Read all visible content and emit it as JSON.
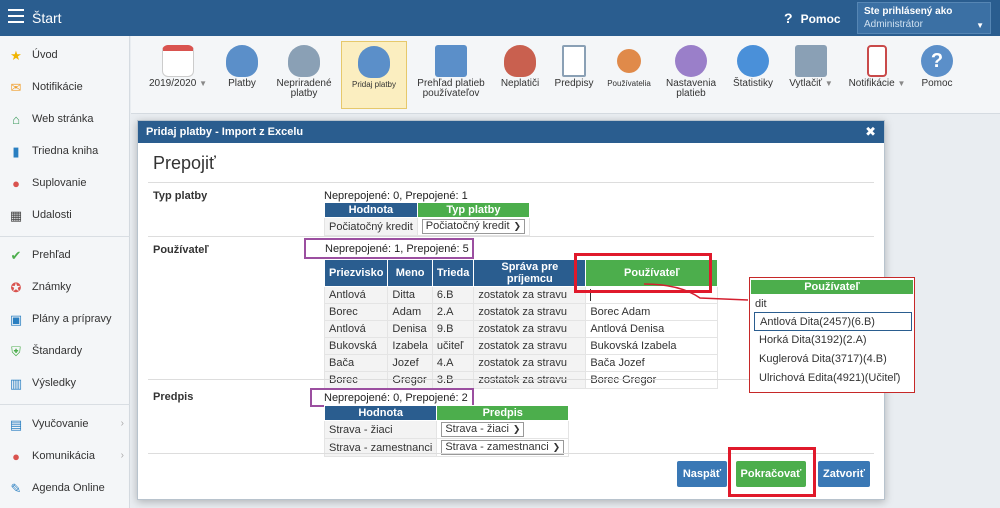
{
  "topbar": {
    "title": "Štart",
    "help": "Pomoc",
    "user_line1": "Ste prihlásený ako",
    "user_line2": "Administrátor"
  },
  "sidebar": [
    {
      "label": "Úvod",
      "icon": "star-icon",
      "color": "#f0b400"
    },
    {
      "label": "Notifikácie",
      "icon": "envelope-icon",
      "color": "#f0a030"
    },
    {
      "label": "Web stránka",
      "icon": "home-icon",
      "color": "#3a9a5b"
    },
    {
      "label": "Triedna kniha",
      "icon": "book-icon",
      "color": "#2a7fc1"
    },
    {
      "label": "Suplovanie",
      "icon": "person-icon",
      "color": "#d9534f"
    },
    {
      "label": "Udalosti",
      "icon": "calendar-icon",
      "color": "#444"
    },
    {
      "label": "Prehľad",
      "icon": "check-circle-icon",
      "color": "#4cae4c"
    },
    {
      "label": "Známky",
      "icon": "grade-icon",
      "color": "#d9534f"
    },
    {
      "label": "Plány a prípravy",
      "icon": "briefcase-icon",
      "color": "#2a7fc1"
    },
    {
      "label": "Štandardy",
      "icon": "shield-icon",
      "color": "#4cae4c"
    },
    {
      "label": "Výsledky",
      "icon": "bar-chart-icon",
      "color": "#2a7fc1"
    },
    {
      "label": "Vyučovanie",
      "icon": "open-book-icon",
      "color": "#2a7fc1"
    },
    {
      "label": "Komunikácia",
      "icon": "chat-icon",
      "color": "#d9534f"
    },
    {
      "label": "Agenda Online",
      "icon": "pen-icon",
      "color": "#2a7fc1"
    }
  ],
  "toolbar": [
    {
      "label": "2019/2020",
      "icon": "calendar-icon",
      "color": "#f2f2f2"
    },
    {
      "label": "Platby",
      "icon": "money-bag-icon",
      "color": "#5b8fc9"
    },
    {
      "label": "Nepriradené platby",
      "icon": "money-bag-question-icon",
      "color": "#8aa0b5"
    },
    {
      "label": "Pridaj platby",
      "icon": "money-bag-add-icon",
      "color": "#5b8fc9"
    },
    {
      "label": "Prehľad platieb používateľov",
      "icon": "ledger-icon",
      "color": "#5b8fc9"
    },
    {
      "label": "Neplatiči",
      "icon": "money-bag-clock-icon",
      "color": "#c9604f"
    },
    {
      "label": "Predpisy",
      "icon": "document-icon",
      "color": "#8aa0b5"
    },
    {
      "label": "Používatelia",
      "icon": "user-icon",
      "color": "#e08a4a"
    },
    {
      "label": "Nastavenia platieb",
      "icon": "gear-icon",
      "color": "#9a7fc9"
    },
    {
      "label": "Štatistiky",
      "icon": "chart-icon",
      "color": "#4a90d9"
    },
    {
      "label": "Vytlačiť",
      "icon": "printer-icon",
      "color": "#8aa0b5"
    },
    {
      "label": "Notifikácie",
      "icon": "phone-icon",
      "color": "#c94a4a"
    },
    {
      "label": "Pomoc",
      "icon": "help-icon",
      "color": "#5b8fc9"
    }
  ],
  "dialog": {
    "header": "Pridaj platby - Import z Excelu",
    "title": "Prepojiť",
    "typ": {
      "label": "Typ platby",
      "summary": "Neprepojené: 0, Prepojené: 1",
      "headers": [
        "Hodnota",
        "Typ platby"
      ],
      "rows": [
        [
          "Počiatočný kredit",
          "Počiatočný kredit"
        ]
      ]
    },
    "pouzivatel": {
      "label": "Používateľ",
      "summary": "Neprepojené: 1, Prepojené: 5",
      "headers": [
        "Priezvisko",
        "Meno",
        "Trieda",
        "Správa pre príjemcu",
        "Používateľ"
      ],
      "rows": [
        [
          "Antlová",
          "Ditta",
          "6.B",
          "zostatok za stravu",
          ""
        ],
        [
          "Borec",
          "Adam",
          "2.A",
          "zostatok za stravu",
          "Borec Adam"
        ],
        [
          "Antlová",
          "Denisa",
          "9.B",
          "zostatok za stravu",
          "Antlová Denisa"
        ],
        [
          "Bukovská",
          "Izabela",
          "učiteľ",
          "zostatok za stravu",
          "Bukovská Izabela"
        ],
        [
          "Bača",
          "Jozef",
          "4.A",
          "zostatok za stravu",
          "Bača Jozef"
        ],
        [
          "Borec",
          "Gregor",
          "3.B",
          "zostatok za stravu",
          "Borec Gregor"
        ]
      ]
    },
    "predpis": {
      "label": "Predpis",
      "summary": "Neprepojené: 0, Prepojené: 2",
      "headers": [
        "Hodnota",
        "Predpis"
      ],
      "rows": [
        [
          "Strava - žiaci",
          "Strava - žiaci"
        ],
        [
          "Strava - zamestnanci",
          "Strava - zamestnanci"
        ]
      ]
    },
    "buttons": {
      "back": "Naspäť",
      "continue": "Pokračovať",
      "close": "Zatvoriť"
    }
  },
  "popup": {
    "header": "Používateľ",
    "input": "dit",
    "options": [
      "Antlová Dita(2457)(6.B)",
      "Horká Dita(3192)(2.A)",
      "Kuglerová Dita(3717)(4.B)",
      "Ulrichová Edita(4921)(Učiteľ)"
    ]
  }
}
